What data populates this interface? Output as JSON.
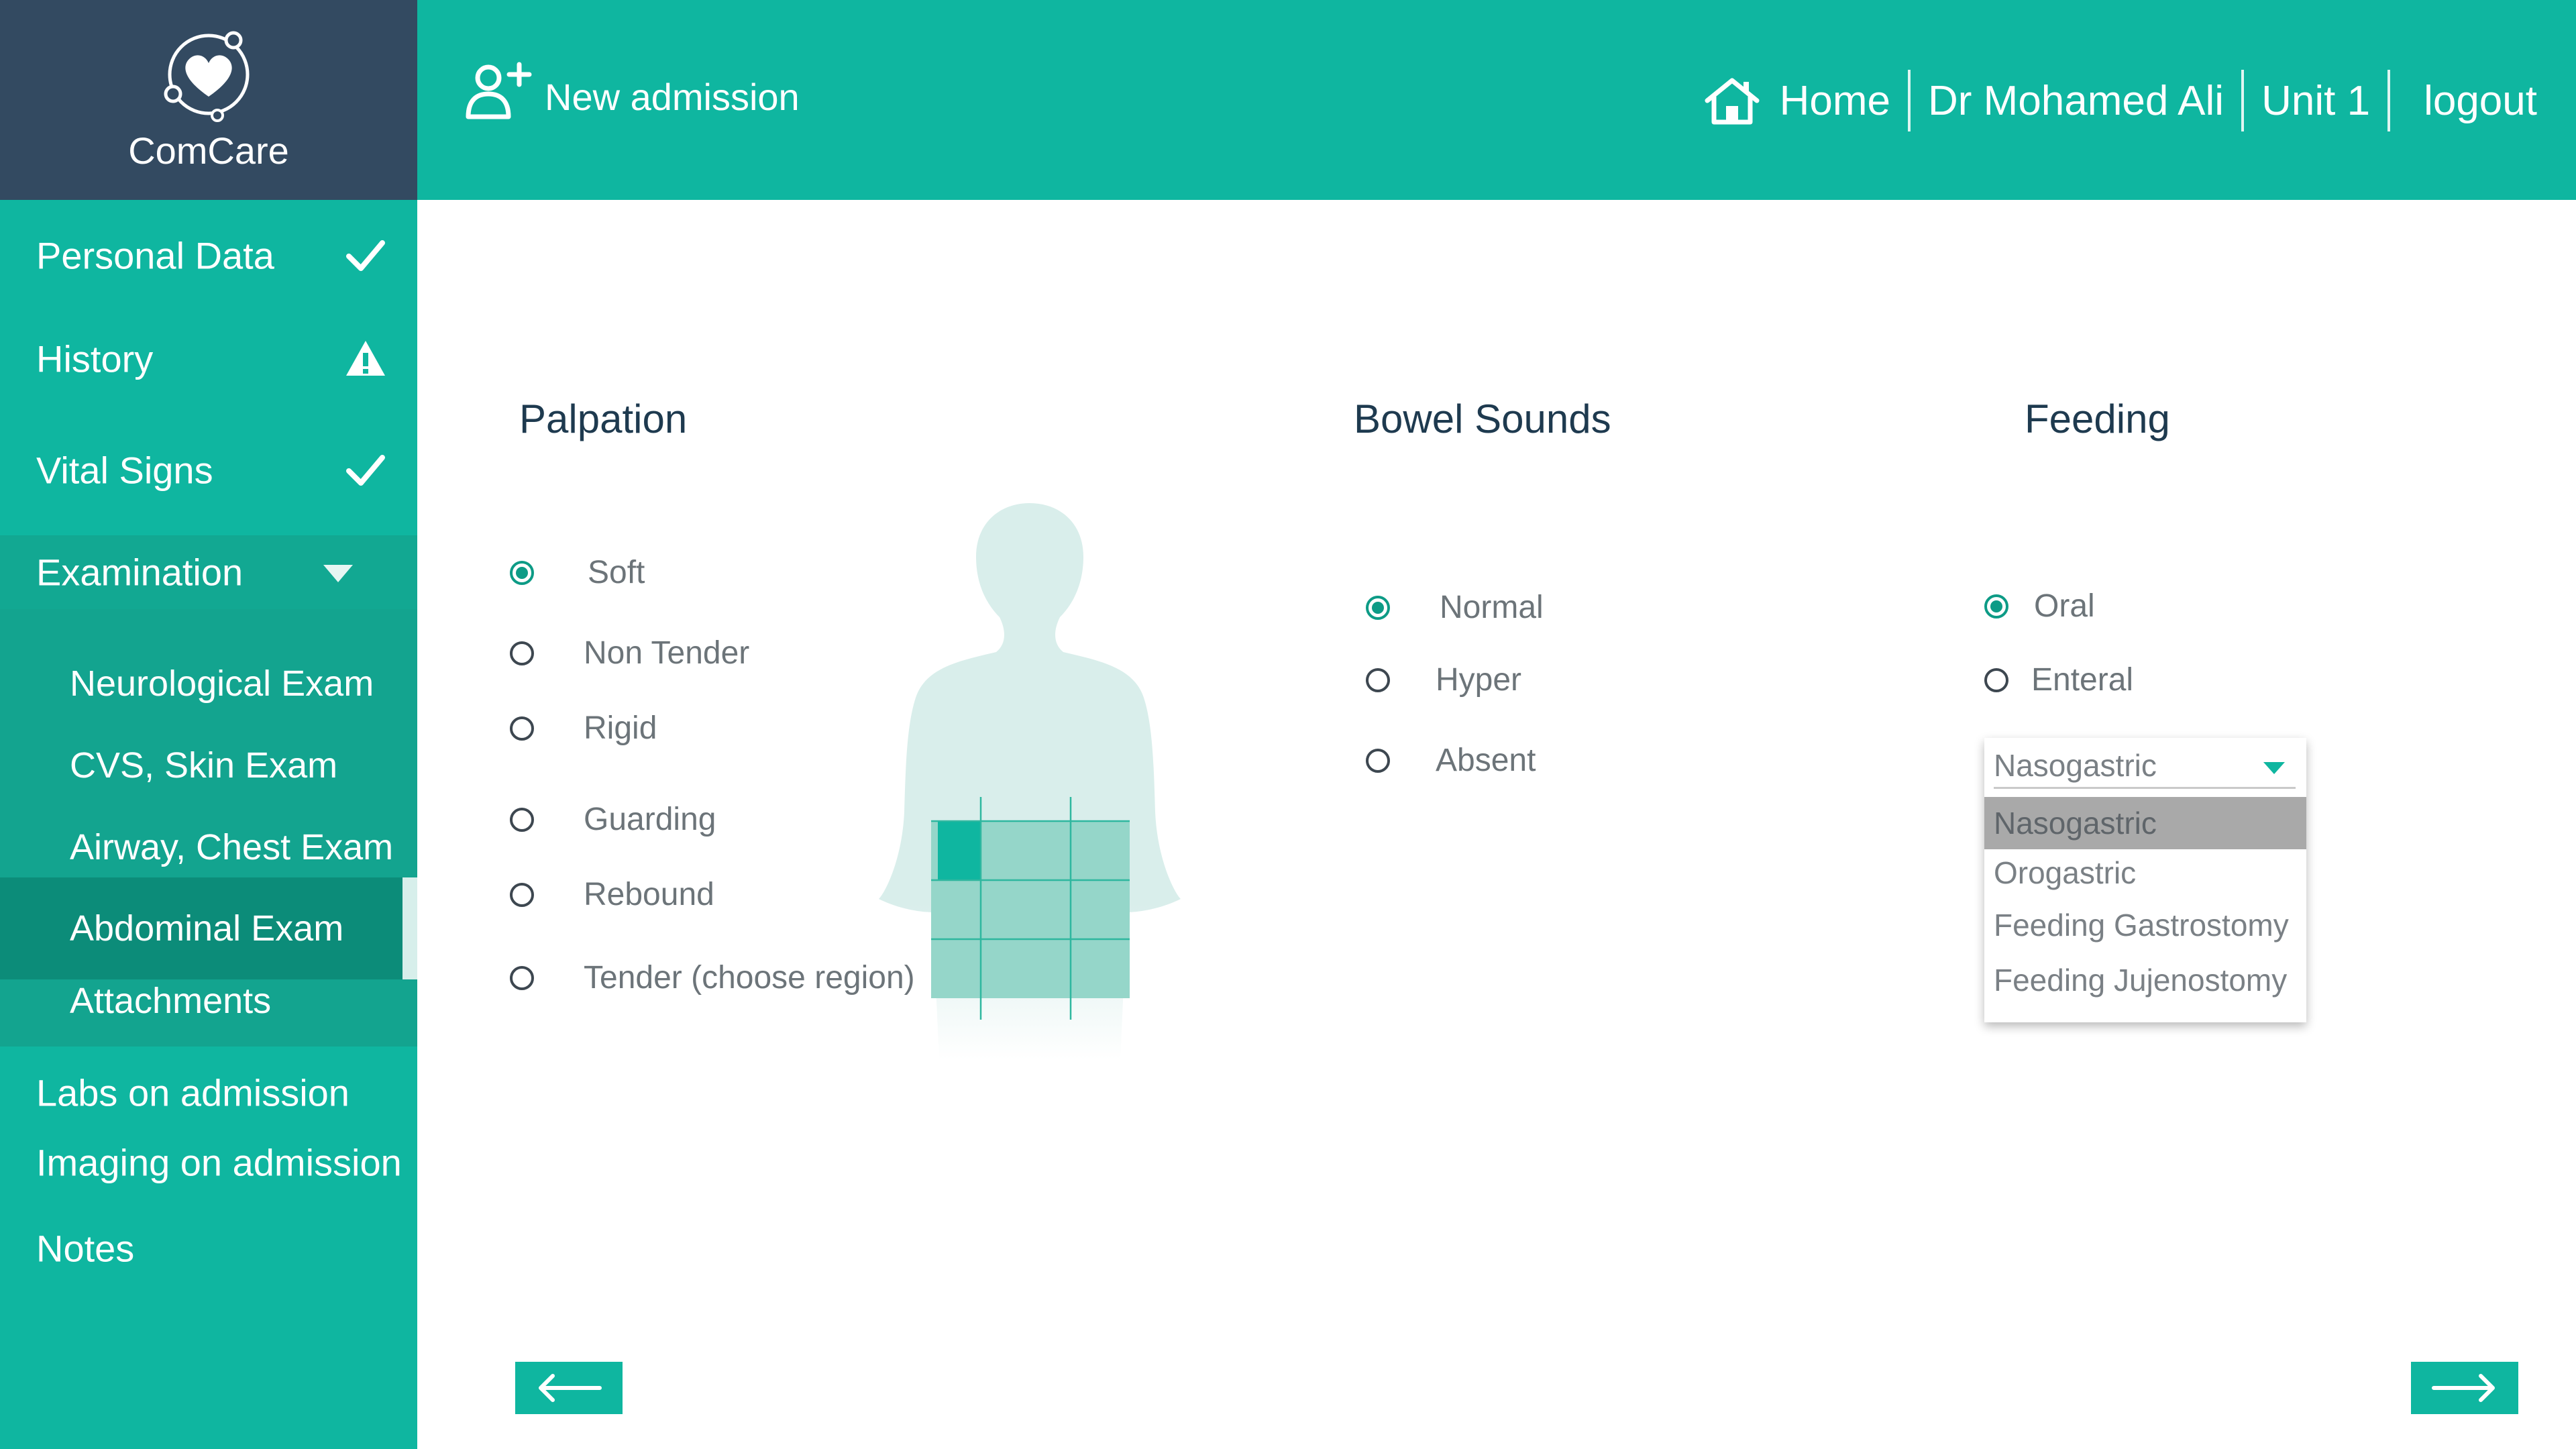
{
  "brand": {
    "name": "ComCare",
    "accent": "#0fb6a0",
    "dark": "#334a61"
  },
  "sidebar": {
    "top_items": [
      {
        "label": "Personal Data",
        "status_icon": "check-icon"
      },
      {
        "label": "History",
        "status_icon": "warning-icon"
      },
      {
        "label": "Vital Signs",
        "status_icon": "check-icon"
      }
    ],
    "examination": {
      "label": "Examination",
      "sub_items": [
        {
          "label": "Neurological Exam"
        },
        {
          "label": "CVS, Skin Exam"
        },
        {
          "label": "Airway, Chest Exam"
        },
        {
          "label": "Abdominal Exam"
        },
        {
          "label": "Attachments"
        }
      ]
    },
    "bottom_items": [
      {
        "label": "Labs on admission"
      },
      {
        "label": "Imaging on admission"
      },
      {
        "label": "Notes"
      }
    ]
  },
  "header": {
    "new_admission": "New admission",
    "home": "Home",
    "doctor": "Dr Mohamed Ali",
    "unit": "Unit 1",
    "logout": "logout"
  },
  "palpation": {
    "title": "Palpation",
    "options": [
      "Soft",
      "Non Tender",
      "Rigid",
      "Guarding",
      "Rebound",
      "Tender (choose region)"
    ],
    "selected": "Soft"
  },
  "bowel_sounds": {
    "title": "Bowel Sounds",
    "options": [
      "Normal",
      "Hyper",
      "Absent"
    ],
    "selected": "Normal"
  },
  "feeding": {
    "title": "Feeding",
    "options": [
      "Oral",
      "Enteral"
    ],
    "selected": "Oral",
    "dropdown": {
      "value": "Nasogastric",
      "options": [
        "Nasogastric",
        "Orogastric",
        "Feeding Gastrostomy",
        "Feeding Jujenostomy"
      ]
    }
  }
}
